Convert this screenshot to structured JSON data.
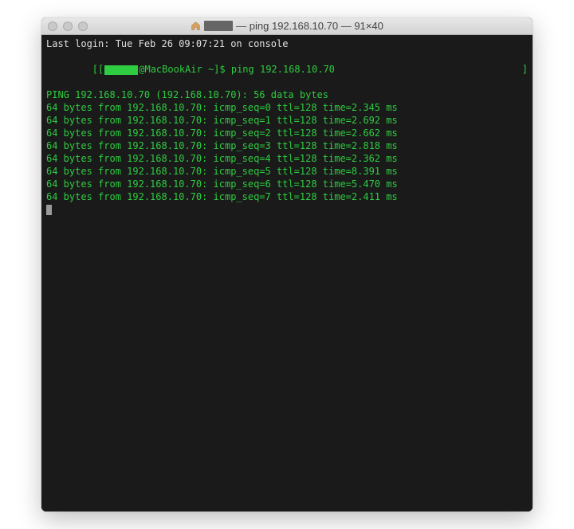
{
  "window": {
    "title_suffix": "— ping 192.168.10.70 — 91×40"
  },
  "terminal": {
    "last_login": "Last login: Tue Feb 26 09:07:21 on console",
    "prompt_open": "[[",
    "prompt_host": "@MacBookAir ~]$ ",
    "command": "ping 192.168.10.70",
    "prompt_close": "]",
    "ping_header": "PING 192.168.10.70 (192.168.10.70): 56 data bytes",
    "replies": [
      "64 bytes from 192.168.10.70: icmp_seq=0 ttl=128 time=2.345 ms",
      "64 bytes from 192.168.10.70: icmp_seq=1 ttl=128 time=2.692 ms",
      "64 bytes from 192.168.10.70: icmp_seq=2 ttl=128 time=2.662 ms",
      "64 bytes from 192.168.10.70: icmp_seq=3 ttl=128 time=2.818 ms",
      "64 bytes from 192.168.10.70: icmp_seq=4 ttl=128 time=2.362 ms",
      "64 bytes from 192.168.10.70: icmp_seq=5 ttl=128 time=8.391 ms",
      "64 bytes from 192.168.10.70: icmp_seq=6 ttl=128 time=5.470 ms",
      "64 bytes from 192.168.10.70: icmp_seq=7 ttl=128 time=2.411 ms"
    ]
  }
}
